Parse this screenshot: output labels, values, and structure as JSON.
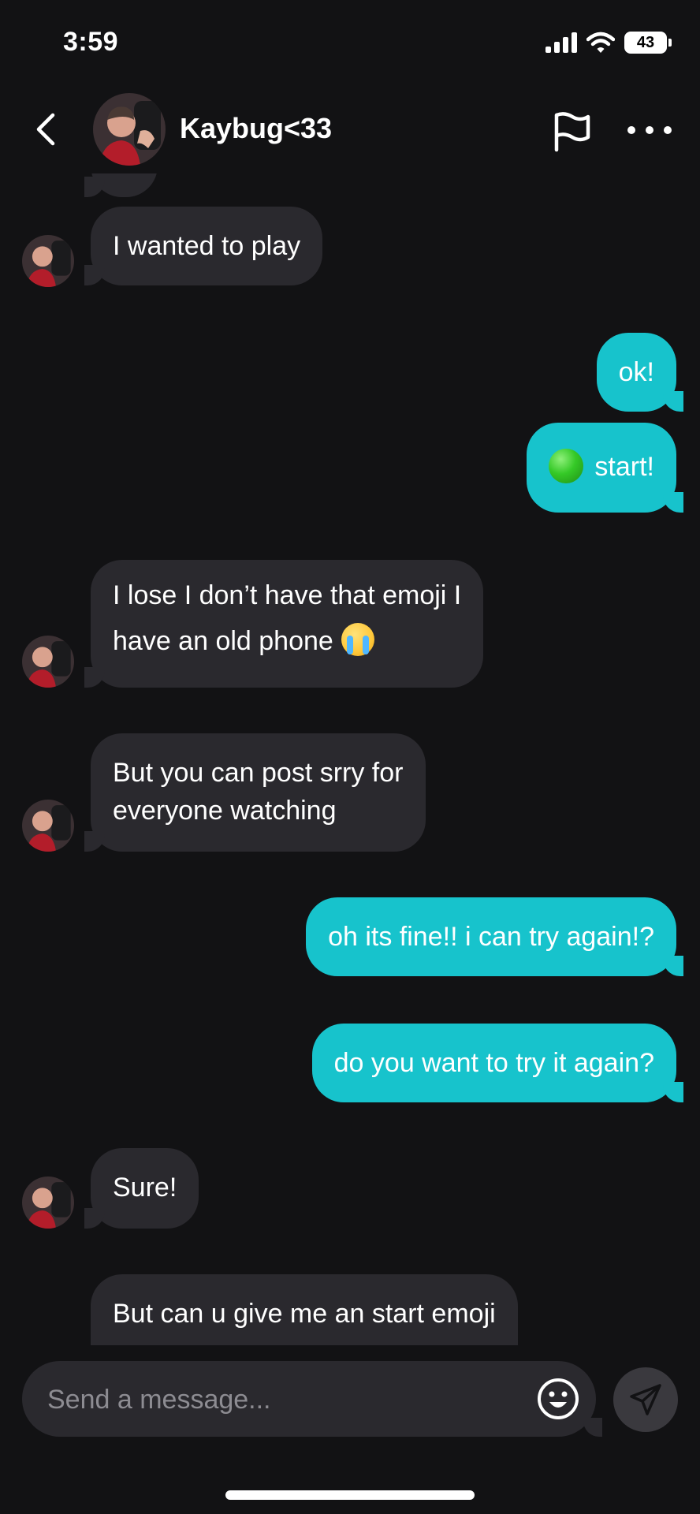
{
  "status_bar": {
    "time": "3:59",
    "battery": "43"
  },
  "header": {
    "contact_name": "Kaybug<33"
  },
  "messages": [
    {
      "from": "them",
      "text": "I wanted to play"
    },
    {
      "from": "me",
      "text": "ok!"
    },
    {
      "from": "me",
      "emoji": "green-circle-emoji",
      "text": "start!"
    },
    {
      "from": "them",
      "line1": "I lose I don’t have that emoji I",
      "line2": "have an old phone",
      "emoji": "loudly-crying-emoji"
    },
    {
      "from": "them",
      "line1": "But you can post srry for",
      "line2": "everyone watching"
    },
    {
      "from": "me",
      "text": "oh its fine!! i can try again!?"
    },
    {
      "from": "me",
      "text": "do you want to try it again?"
    },
    {
      "from": "them",
      "text": "Sure!"
    },
    {
      "from": "them",
      "text": "But can u give me an start emoji"
    }
  ],
  "composer": {
    "placeholder": "Send a message..."
  },
  "colors": {
    "background": "#121214",
    "received_bubble": "#2a292e",
    "sent_bubble": "#17c3cc"
  }
}
